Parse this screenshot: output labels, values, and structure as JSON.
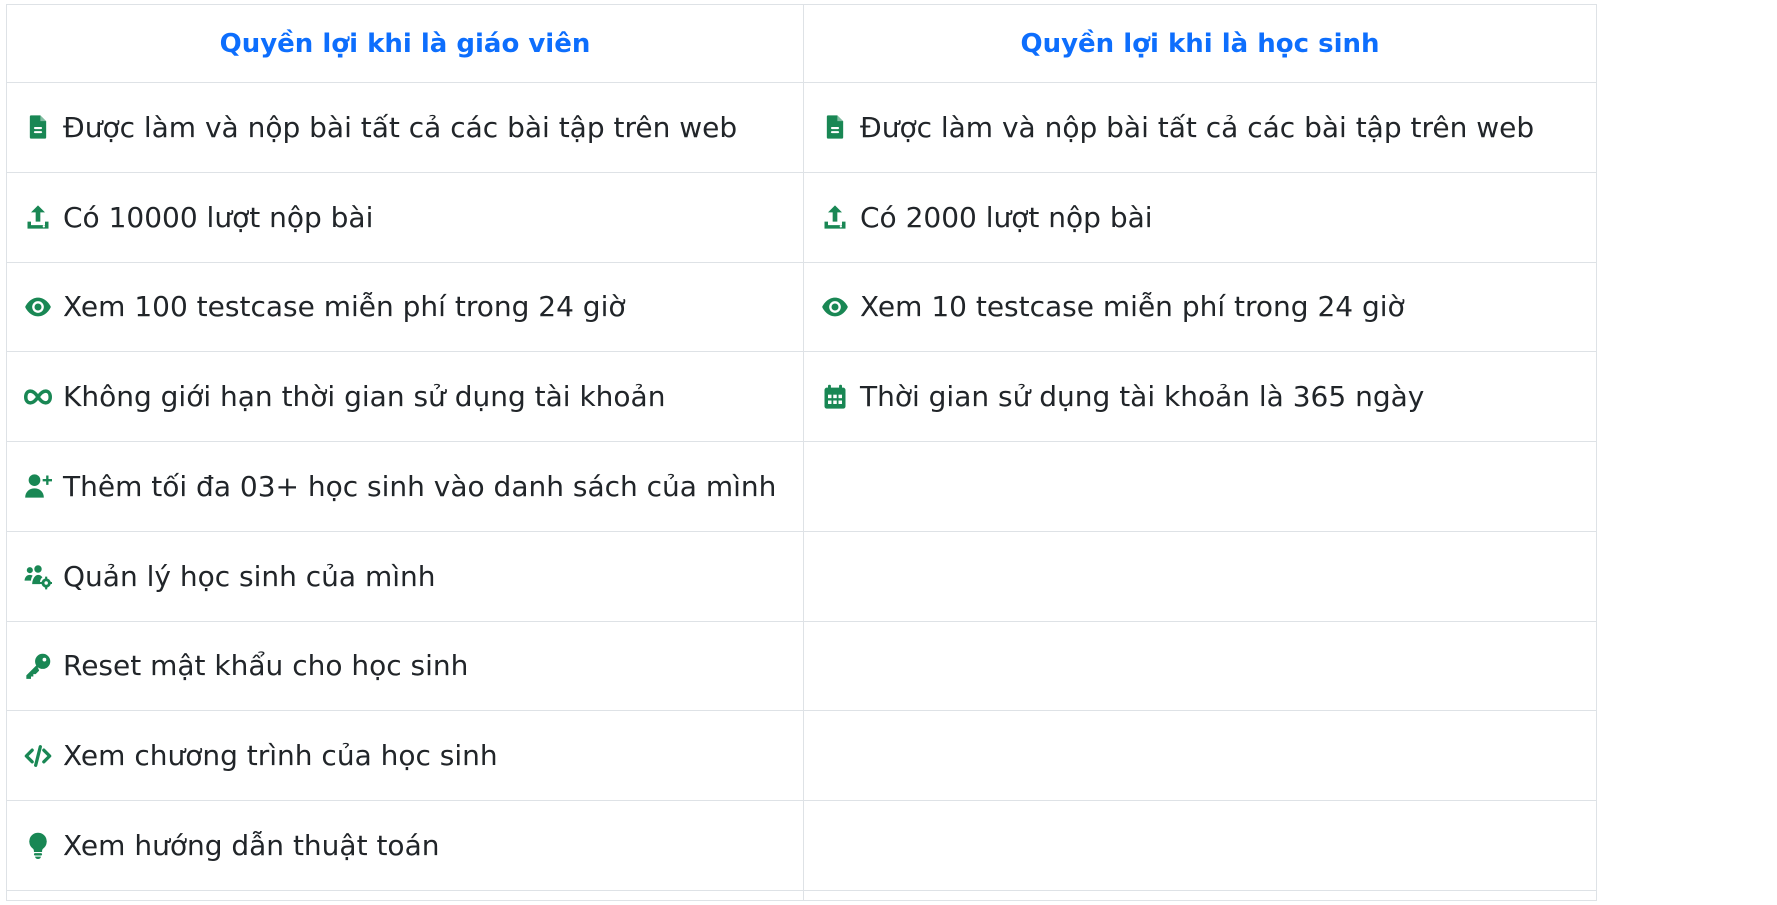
{
  "colors": {
    "header_text": "#0d6efd",
    "icon": "#198754",
    "border": "#dee2e6",
    "text": "#212529"
  },
  "headers": {
    "teacher": "Quyền lợi khi là giáo viên",
    "student": "Quyền lợi khi là học sinh"
  },
  "teacher": [
    {
      "icon": "file-icon",
      "label": "Được làm và nộp bài tất cả các bài tập trên web"
    },
    {
      "icon": "upload-icon",
      "label": "Có 10000 lượt nộp bài"
    },
    {
      "icon": "eye-icon",
      "label": "Xem 100 testcase miễn phí trong 24 giờ"
    },
    {
      "icon": "infinity-icon",
      "label": "Không giới hạn thời gian sử dụng tài khoản"
    },
    {
      "icon": "user-plus-icon",
      "label": "Thêm tối đa 03+ học sinh vào danh sách của mình"
    },
    {
      "icon": "users-gear-icon",
      "label": "Quản lý học sinh của mình"
    },
    {
      "icon": "key-icon",
      "label": "Reset mật khẩu cho học sinh"
    },
    {
      "icon": "code-icon",
      "label": "Xem chương trình của học sinh"
    },
    {
      "icon": "lightbulb-icon",
      "label": "Xem hướng dẫn thuật toán"
    }
  ],
  "student": [
    {
      "icon": "file-icon",
      "label": "Được làm và nộp bài tất cả các bài tập trên web"
    },
    {
      "icon": "upload-icon",
      "label": "Có 2000 lượt nộp bài"
    },
    {
      "icon": "eye-icon",
      "label": "Xem 10 testcase miễn phí trong 24 giờ"
    },
    {
      "icon": "calendar-icon",
      "label": "Thời gian sử dụng tài khoản là 365 ngày"
    }
  ]
}
